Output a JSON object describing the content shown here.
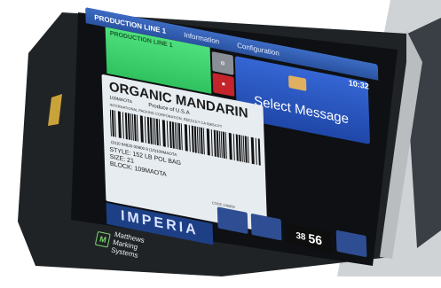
{
  "topbar": {
    "items": [
      {
        "label": "PRODUCTION LINE 1",
        "active": true
      },
      {
        "label": "Information"
      },
      {
        "label": "Configuration"
      }
    ]
  },
  "status": {
    "production_line": "PRODUCTION LINE 1",
    "clock": "10:32"
  },
  "select_message": {
    "label": "Select Message"
  },
  "label_preview": {
    "title": "ORGANIC MANDARIN",
    "lot": "109MAOTA",
    "produce_of": "Produce of U.S.A",
    "grower_line": "INTERNATIONAL PACKING CORPORATION, REEDLEY CA 93654 PT",
    "barcode_text": "(01)0 84820 00800 8 (10)109MAOTA",
    "style_line1": "STYLE: 152 LB POL BAG",
    "style_line2": "SIZE: 21",
    "style_line3": "BLOCK: 109MAOTA",
    "code": "CODE 246808"
  },
  "counter": {
    "left": "38",
    "right": "56"
  },
  "logo_text": "IMPERIA",
  "brand": {
    "line1": "Matthews",
    "line2": "Marking Systems",
    "mark": "M"
  },
  "colors": {
    "topbar": "#2f5ab4",
    "prodline_green": "#35c864",
    "select_message_blue": "#2a58c2",
    "label_bg": "#e7ecf0",
    "accent_yellow": "#e8b424"
  }
}
